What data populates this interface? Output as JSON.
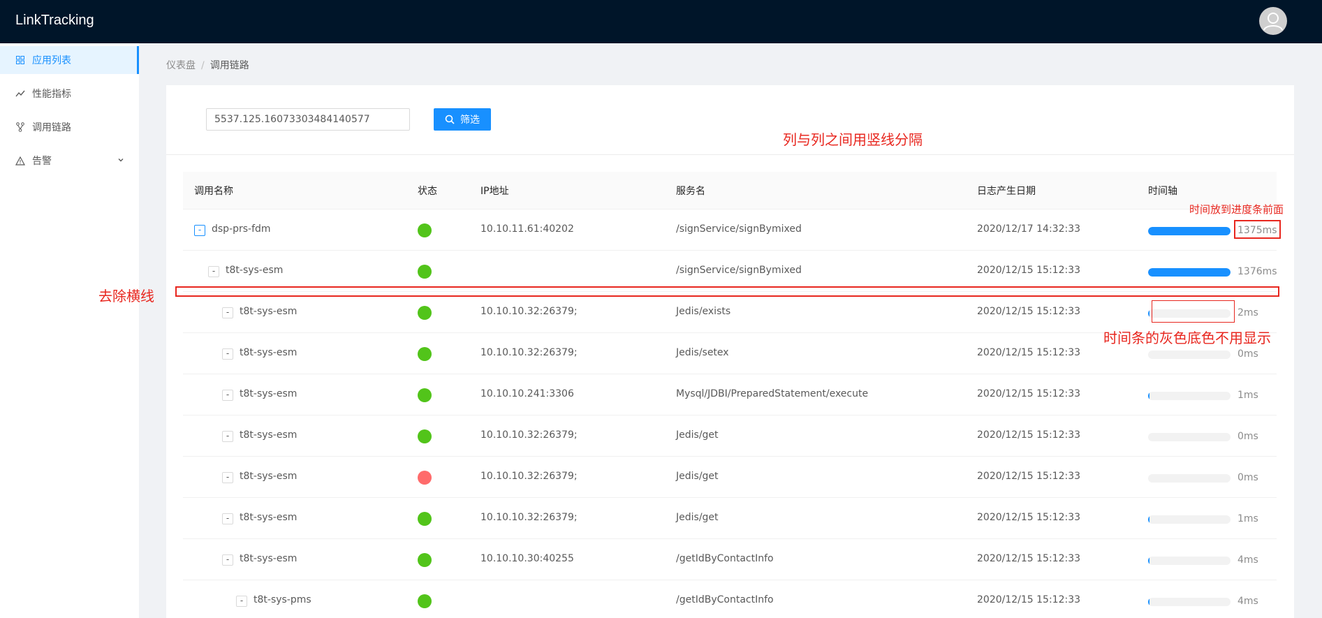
{
  "app": {
    "title": "LinkTracking"
  },
  "sidebar": {
    "items": [
      {
        "label": "应用列表",
        "icon": "grid-icon",
        "active": true
      },
      {
        "label": "性能指标",
        "icon": "line-chart-icon",
        "active": false
      },
      {
        "label": "调用链路",
        "icon": "branch-icon",
        "active": false
      },
      {
        "label": "告警",
        "icon": "warning-icon",
        "active": false,
        "has_submenu": true
      }
    ]
  },
  "breadcrumb": {
    "items": [
      "仪表盘",
      "调用链路"
    ],
    "separator": "/"
  },
  "filter": {
    "value": "5537.125.16073303484140577",
    "button_label": "筛选"
  },
  "table": {
    "columns": [
      "调用名称",
      "状态",
      "IP地址",
      "服务名",
      "日志产生日期",
      "时间轴"
    ],
    "rows": [
      {
        "name": "dsp-prs-fdm",
        "level": 0,
        "status": "success",
        "ip": "10.10.11.61:40202",
        "service": "/signService/signBymixed",
        "date": "2020/12/17 14:32:33",
        "progress": 1.0,
        "duration": "1375ms"
      },
      {
        "name": "t8t-sys-esm",
        "level": 1,
        "status": "success",
        "ip": "",
        "service": "/signService/signBymixed",
        "date": "2020/12/15 15:12:33",
        "progress": 1.0,
        "duration": "1376ms"
      },
      {
        "name": "t8t-sys-esm",
        "level": 2,
        "status": "success",
        "ip": "10.10.10.32:26379;",
        "service": "Jedis/exists",
        "date": "2020/12/15 15:12:33",
        "progress": 0.01,
        "duration": "2ms"
      },
      {
        "name": "t8t-sys-esm",
        "level": 2,
        "status": "success",
        "ip": "10.10.10.32:26379;",
        "service": "Jedis/setex",
        "date": "2020/12/15 15:12:33",
        "progress": 0,
        "duration": "0ms"
      },
      {
        "name": "t8t-sys-esm",
        "level": 2,
        "status": "success",
        "ip": "10.10.10.241:3306",
        "service": "Mysql/JDBI/PreparedStatement/execute",
        "date": "2020/12/15 15:12:33",
        "progress": 0.01,
        "duration": "1ms"
      },
      {
        "name": "t8t-sys-esm",
        "level": 2,
        "status": "success",
        "ip": "10.10.10.32:26379;",
        "service": "Jedis/get",
        "date": "2020/12/15 15:12:33",
        "progress": 0,
        "duration": "0ms"
      },
      {
        "name": "t8t-sys-esm",
        "level": 2,
        "status": "error",
        "ip": "10.10.10.32:26379;",
        "service": "Jedis/get",
        "date": "2020/12/15 15:12:33",
        "progress": 0,
        "duration": "0ms"
      },
      {
        "name": "t8t-sys-esm",
        "level": 2,
        "status": "success",
        "ip": "10.10.10.32:26379;",
        "service": "Jedis/get",
        "date": "2020/12/15 15:12:33",
        "progress": 0.01,
        "duration": "1ms"
      },
      {
        "name": "t8t-sys-esm",
        "level": 2,
        "status": "success",
        "ip": "10.10.10.30:40255",
        "service": "/getIdByContactInfo",
        "date": "2020/12/15 15:12:33",
        "progress": 0.015,
        "duration": "4ms"
      },
      {
        "name": "t8t-sys-pms",
        "level": 3,
        "status": "success",
        "ip": "",
        "service": "/getIdByContactInfo",
        "date": "2020/12/15 15:12:33",
        "progress": 0.015,
        "duration": "4ms"
      }
    ]
  },
  "annotations": {
    "column_separator": "列与列之间用竖线分隔",
    "time_before_bar": "时间放到进度条前面",
    "remove_line": "去除横线",
    "no_gray_bg": "时间条的灰色底色不用显示"
  },
  "colors": {
    "accent": "#1890ff",
    "success": "#52c41a",
    "error": "#ff6b6b",
    "annotation": "#e8271f",
    "header_bg": "#001529"
  }
}
